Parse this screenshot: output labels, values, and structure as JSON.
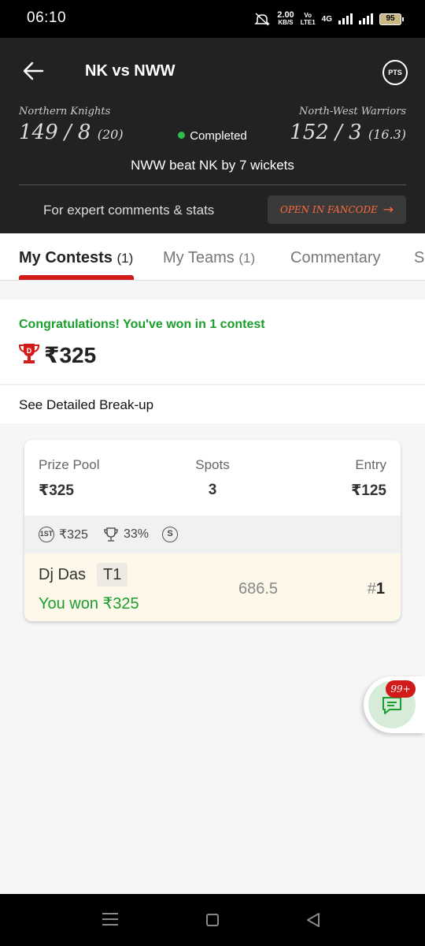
{
  "status_bar": {
    "time": "06:10",
    "net_speed": "2.00",
    "net_unit": "KB/S",
    "volte_top": "Vo",
    "volte_bottom": "LTE1",
    "network": "4G",
    "battery": "95"
  },
  "header": {
    "title": "NK vs NWW",
    "pts_label": "PTS",
    "team1": {
      "name": "Northern Knights",
      "score": "149 / 8",
      "overs": "(20)"
    },
    "team2": {
      "name": "North-West Warriors",
      "score": "152 / 3",
      "overs": "(16.3)"
    },
    "status": "Completed",
    "result": "NWW beat NK by 7 wickets",
    "expert_text": "For expert comments & stats",
    "fancode_label": "OPEN IN FANCODE",
    "fancode_arrow": "→"
  },
  "tabs": [
    {
      "label": "My Contests",
      "count": "(1)",
      "active": true
    },
    {
      "label": "My Teams",
      "count": "(1)",
      "active": false
    },
    {
      "label": "Commentary",
      "count": "",
      "active": false
    },
    {
      "label": "S",
      "count": "",
      "active": false
    }
  ],
  "winnings": {
    "message": "Congratulations! You've won in 1 contest",
    "amount": "₹325",
    "breakup_label": "See Detailed Break-up"
  },
  "contest": {
    "prize_pool_label": "Prize Pool",
    "prize_pool": "₹325",
    "spots_label": "Spots",
    "spots": "3",
    "entry_label": "Entry",
    "entry": "₹125",
    "first_badge": "1ST",
    "first_prize": "₹325",
    "win_percent": "33%",
    "single_badge": "S",
    "team": {
      "user": "Dj Das",
      "team_code": "T1",
      "won_text": "You won ₹325",
      "points": "686.5",
      "rank_hash": "#",
      "rank": "1"
    }
  },
  "chat": {
    "badge": "99+"
  },
  "colors": {
    "accent_red": "#d11a1a",
    "win_green": "#1a9e2c",
    "header_bg": "#222222",
    "fancode_orange": "#ff6a3d"
  }
}
